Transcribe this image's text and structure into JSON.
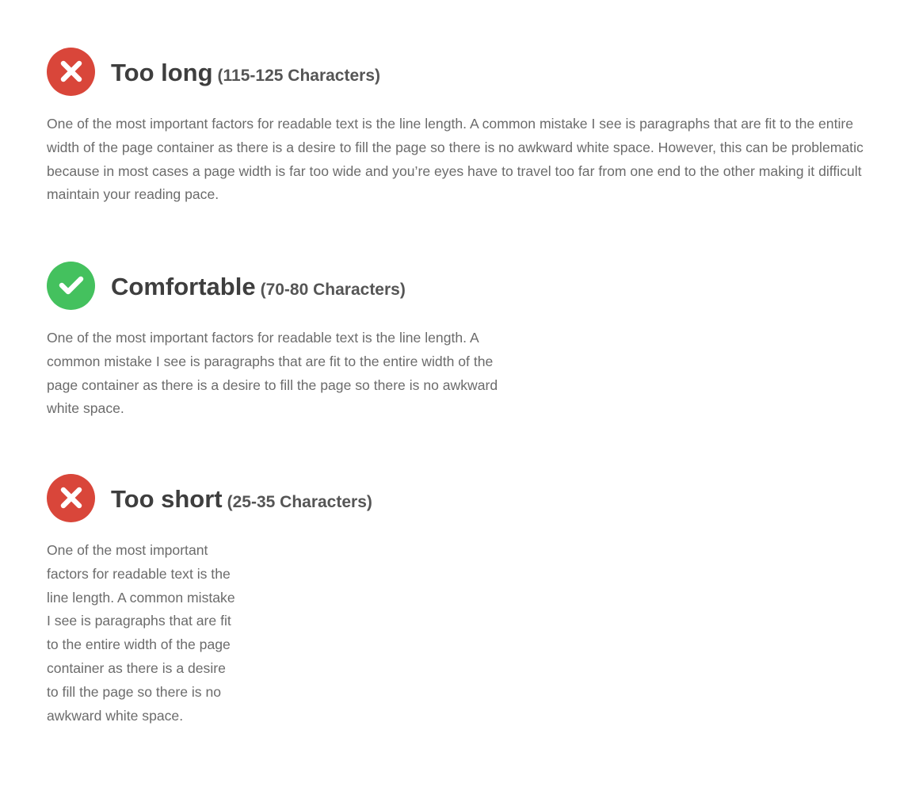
{
  "sections": [
    {
      "status": "bad",
      "status_icon": "x-icon",
      "title": "Too long",
      "range": "(115-125 Characters)",
      "text": "One of the most important factors for readable text is the line length. A common mistake I see is paragraphs that are fit to the entire width of the page container as there is a desire to fill the page so there is no awkward white space. However, this can be problematic because in most cases a page width is far too wide and you’re eyes have to travel too far from one end to the other making it difficult maintain your reading pace."
    },
    {
      "status": "good",
      "status_icon": "check-icon",
      "title": "Comfortable",
      "range": "(70-80 Characters)",
      "text": "One of the most important factors for readable text is the line length. A common mistake I see is paragraphs that are fit to the entire width of the page container as there is a desire to fill the page so there is no awkward white space."
    },
    {
      "status": "bad",
      "status_icon": "x-icon",
      "title": "Too short",
      "range": "(25-35 Characters)",
      "text": "One of the most important factors for readable text is the line length. A common mistake I see is paragraphs that are fit to the entire width of the page container as there is a desire to fill the page so there is no awkward white space."
    }
  ],
  "colors": {
    "bad": "#d9463a",
    "good": "#44c15e",
    "heading": "#3e3e3e",
    "body": "#6b6b6b"
  }
}
